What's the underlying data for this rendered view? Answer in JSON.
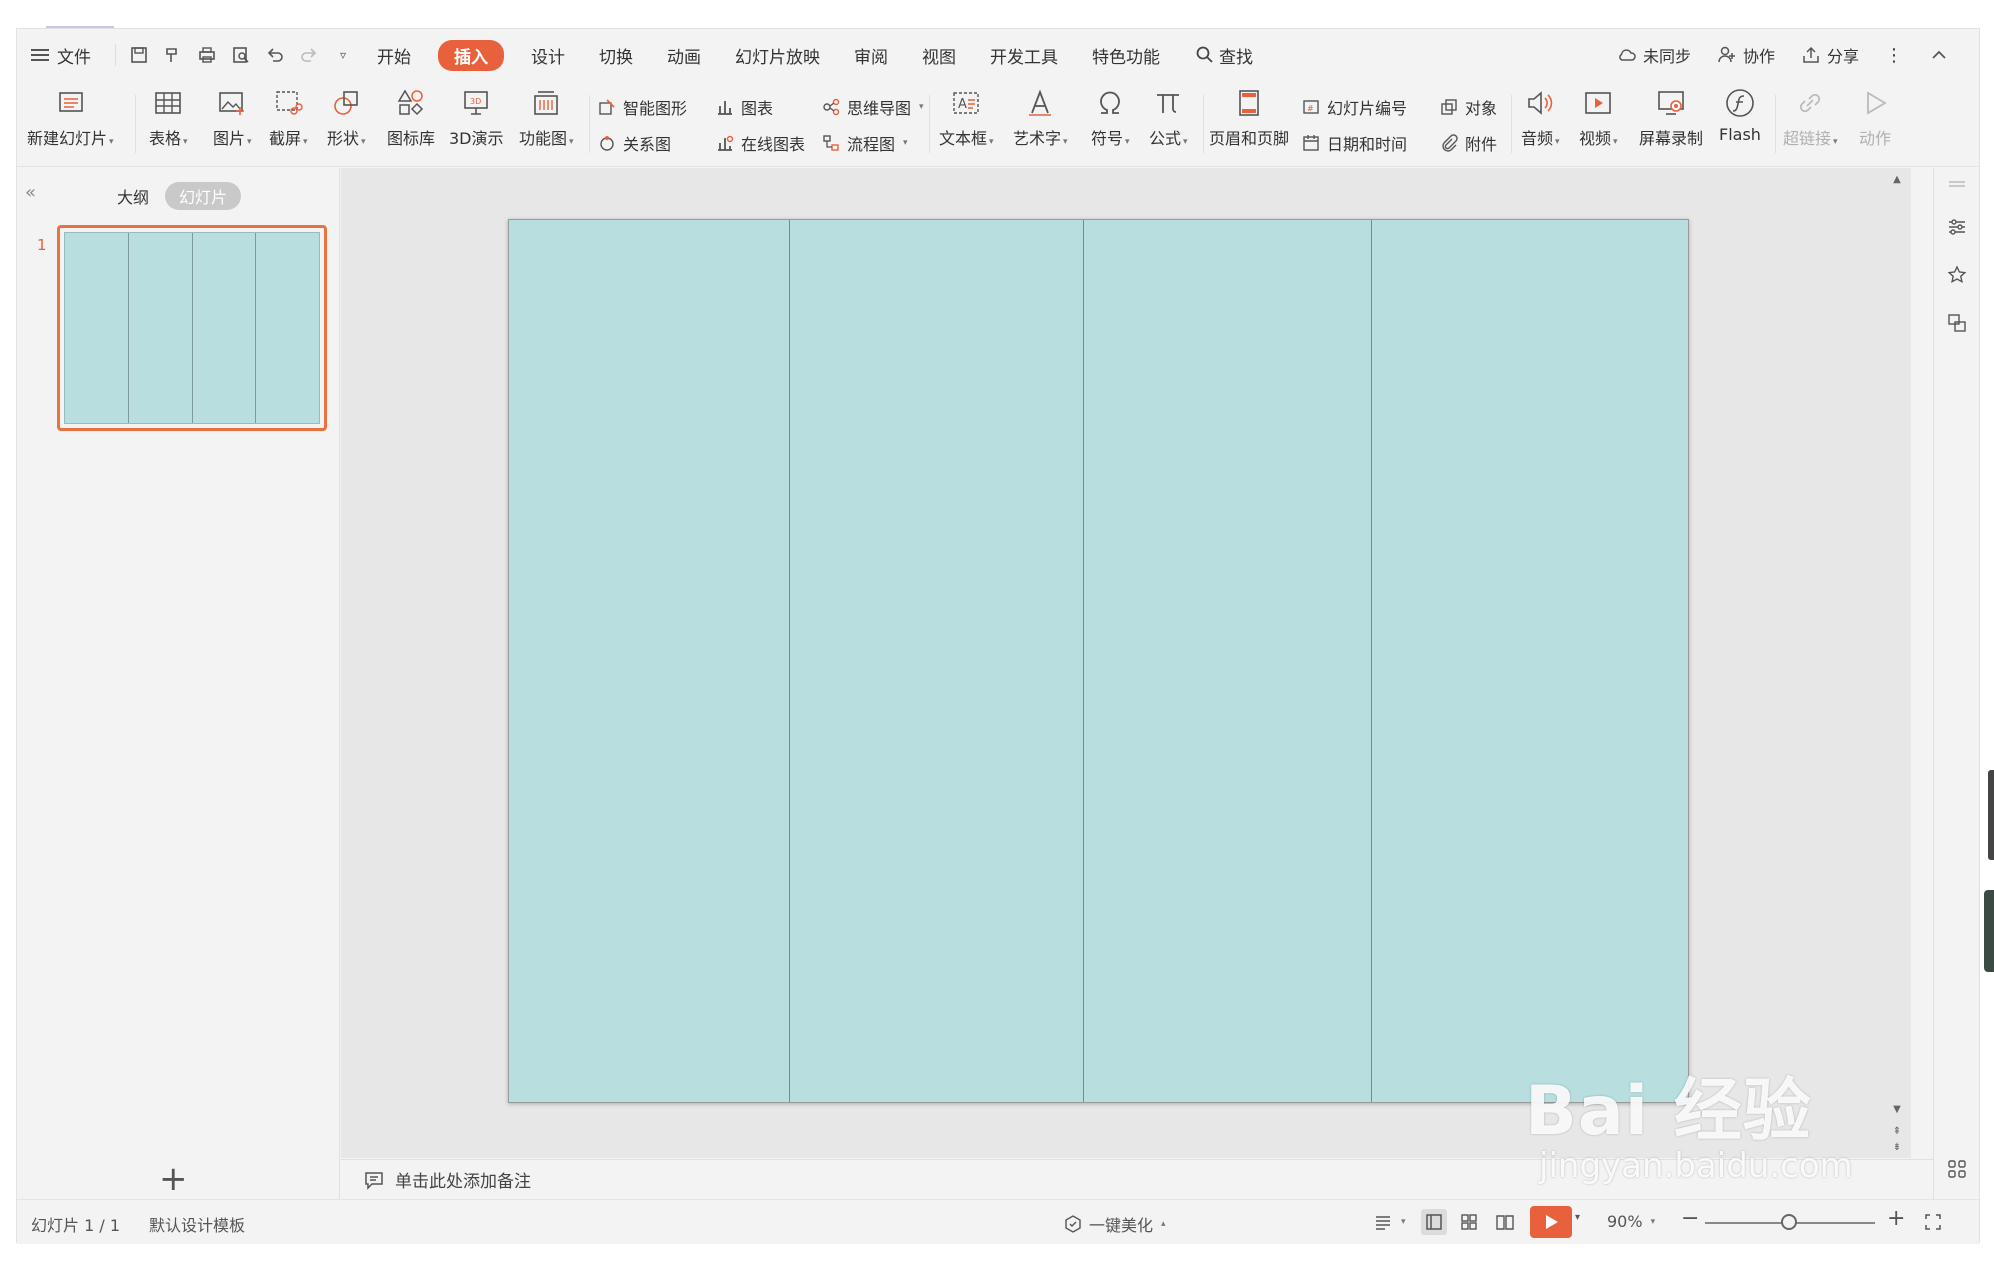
{
  "menubar": {
    "file_label": "文件",
    "tabs": [
      "开始",
      "插入",
      "设计",
      "切换",
      "动画",
      "幻灯片放映",
      "审阅",
      "视图",
      "开发工具",
      "特色功能"
    ],
    "active_tab": "插入",
    "search_label": "查找",
    "right": {
      "sync": "未同步",
      "collab": "协作",
      "share": "分享"
    }
  },
  "ribbon": {
    "new_slide": "新建幻灯片",
    "table": "表格",
    "picture": "图片",
    "screenshot": "截屏",
    "shape": "形状",
    "icon_lib": "图标库",
    "demo3d": "3D演示",
    "func_chart": "功能图",
    "smart_graphic": "智能图形",
    "chart": "图表",
    "relation": "关系图",
    "online_chart": "在线图表",
    "mindmap": "思维导图",
    "flowchart": "流程图",
    "textbox": "文本框",
    "wordart": "艺术字",
    "symbol": "符号",
    "formula": "公式",
    "header_footer": "页眉和页脚",
    "slide_number": "幻灯片编号",
    "object": "对象",
    "datetime": "日期和时间",
    "attachment": "附件",
    "audio": "音频",
    "video": "视频",
    "screen_record": "屏幕录制",
    "flash": "Flash",
    "hyperlink": "超链接",
    "action": "动作"
  },
  "panel": {
    "tab_outline": "大纲",
    "tab_slides": "幻灯片",
    "slide_number": "1"
  },
  "notes_placeholder": "单击此处添加备注",
  "status": {
    "slide_info": "幻灯片 1 / 1",
    "template": "默认设计模板",
    "beautify": "一键美化",
    "zoom": "90%"
  },
  "watermark": {
    "line1": "Bai 经验",
    "line2": "jingyan.baidu.com"
  },
  "colors": {
    "accent": "#e8603c",
    "slide_fill": "#b8dee0",
    "divider": "#6f8e90"
  }
}
